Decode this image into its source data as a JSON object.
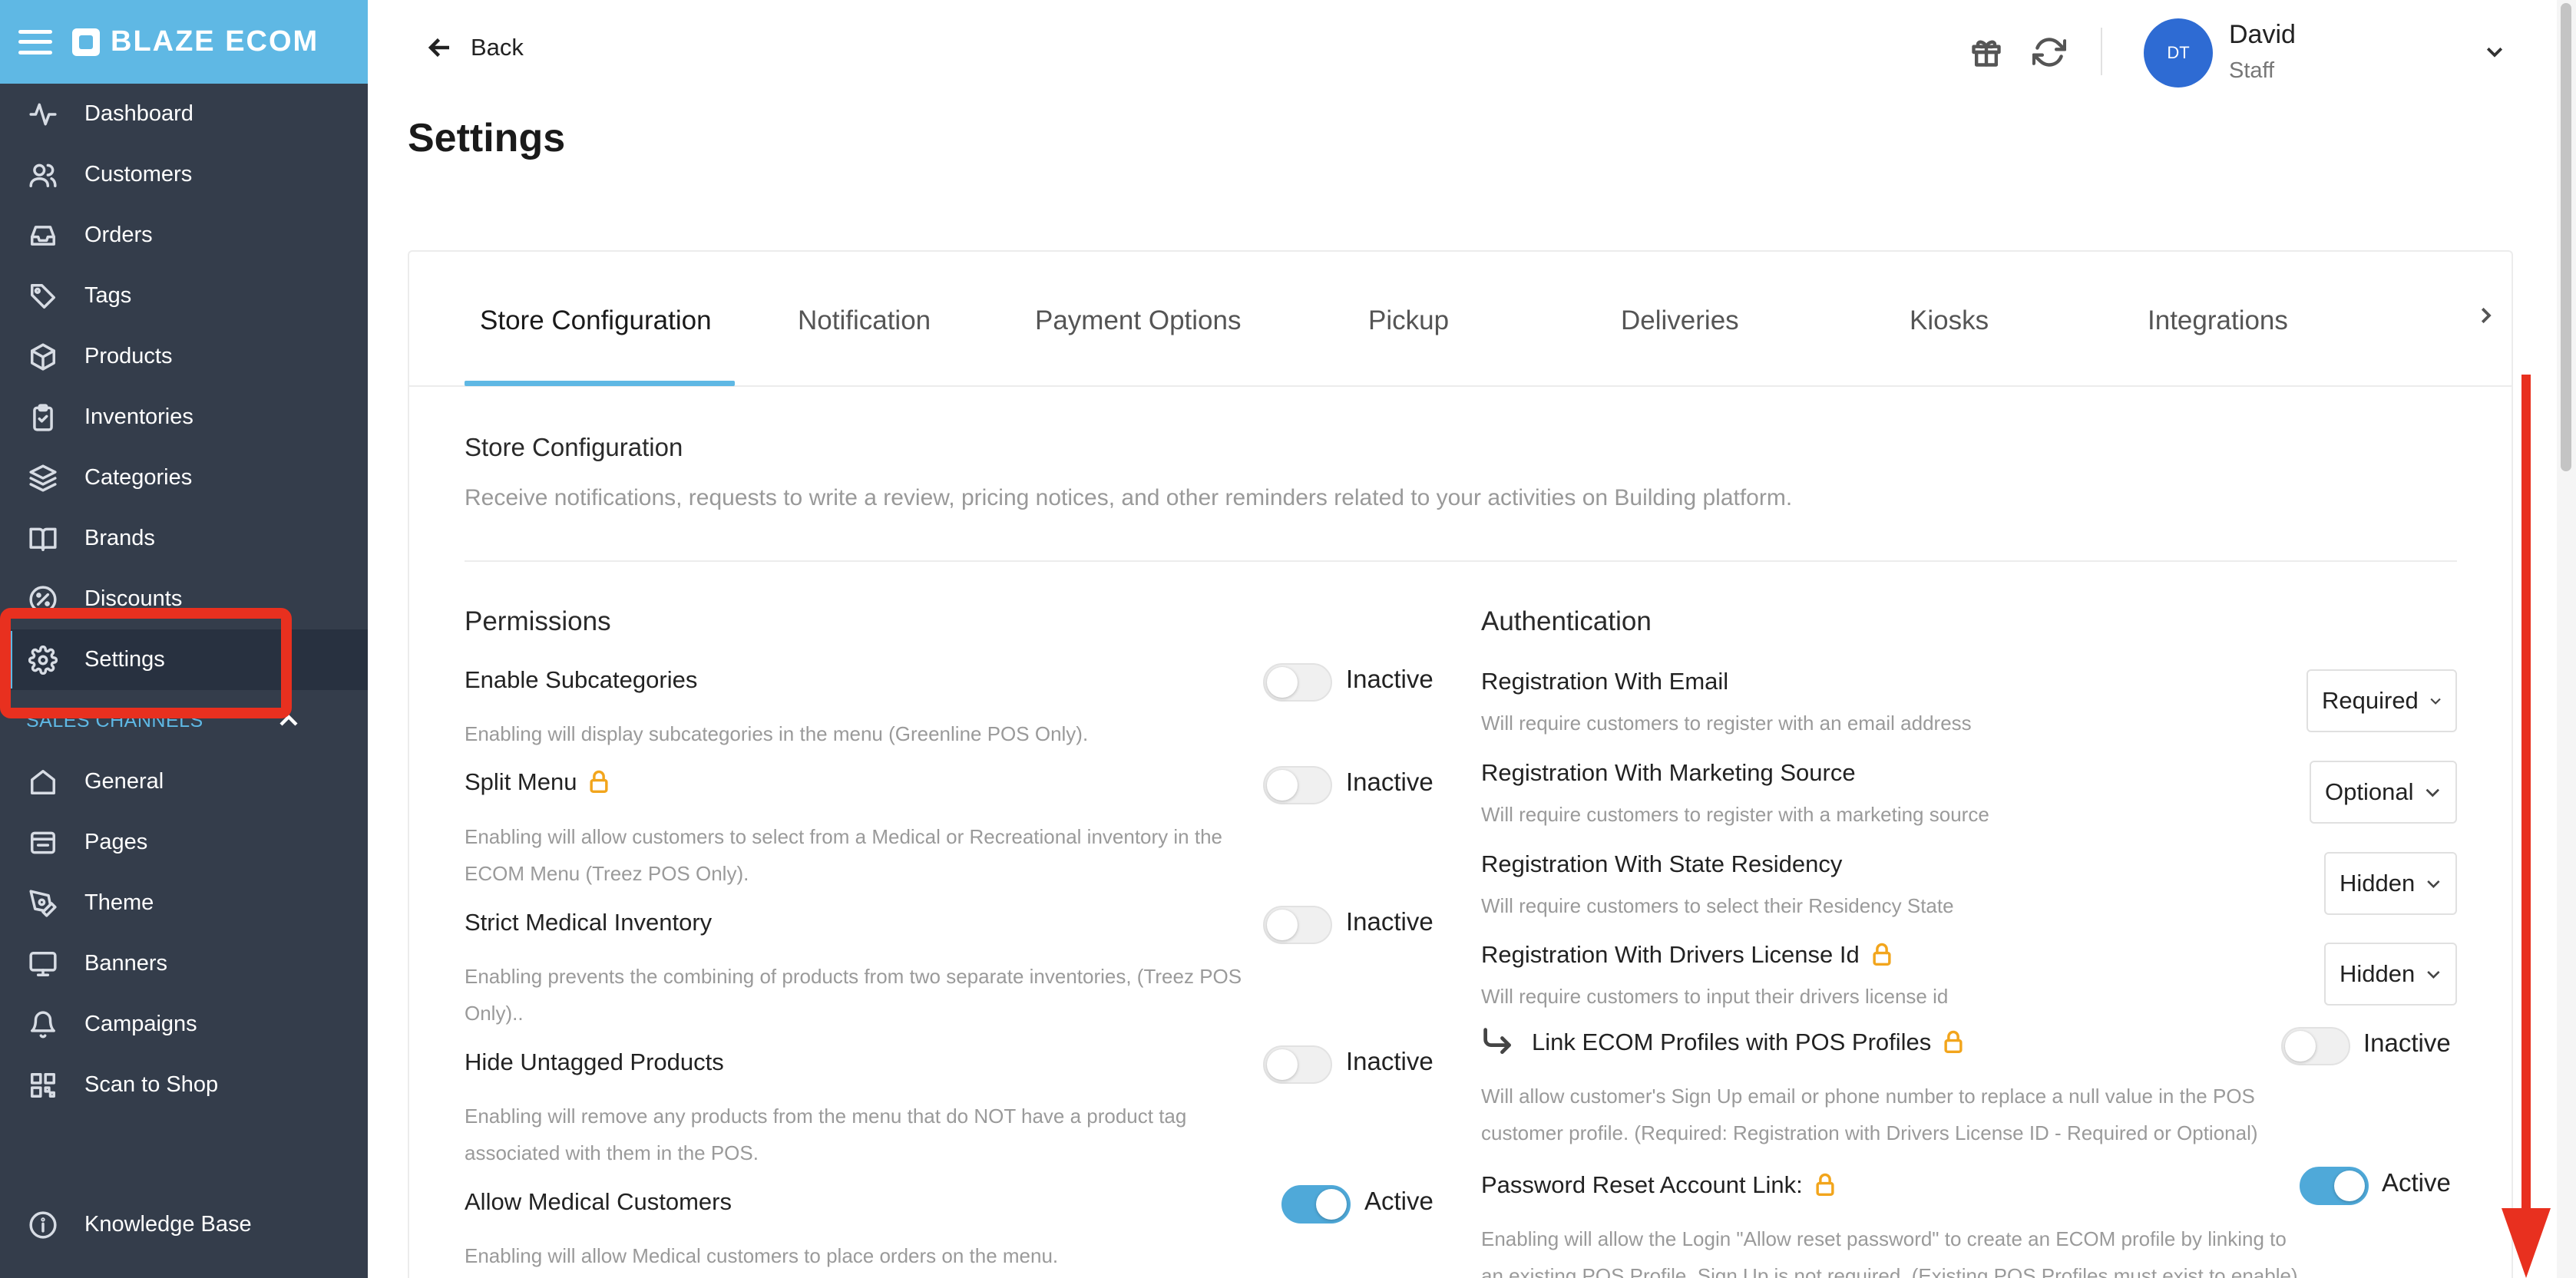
{
  "brand": {
    "name": "BLAZE ECOM"
  },
  "sidebar": {
    "items": [
      {
        "label": "Dashboard"
      },
      {
        "label": "Customers"
      },
      {
        "label": "Orders"
      },
      {
        "label": "Tags"
      },
      {
        "label": "Products"
      },
      {
        "label": "Inventories"
      },
      {
        "label": "Categories"
      },
      {
        "label": "Brands"
      },
      {
        "label": "Discounts"
      },
      {
        "label": "Settings"
      }
    ],
    "sales_channels_label": "SALES CHANNELS",
    "channel_items": [
      {
        "label": "General"
      },
      {
        "label": "Pages"
      },
      {
        "label": "Theme"
      },
      {
        "label": "Banners"
      },
      {
        "label": "Campaigns"
      },
      {
        "label": "Scan to Shop"
      }
    ],
    "knowledge_base_label": "Knowledge Base"
  },
  "header": {
    "back_label": "Back",
    "user_initials": "DT",
    "user_name": "David",
    "user_role": "Staff"
  },
  "page": {
    "title": "Settings"
  },
  "tabs": [
    {
      "label": "Store Configuration"
    },
    {
      "label": "Notification"
    },
    {
      "label": "Payment Options"
    },
    {
      "label": "Pickup"
    },
    {
      "label": "Deliveries"
    },
    {
      "label": "Kiosks"
    },
    {
      "label": "Integrations"
    }
  ],
  "store_config": {
    "title": "Store Configuration",
    "description": "Receive notifications, requests to write a review, pricing notices, and other reminders related to your activities on Building platform."
  },
  "permissions": {
    "title": "Permissions",
    "rows": [
      {
        "label": "Enable Subcategories",
        "state": "Inactive",
        "desc": "Enabling will display subcategories in the menu (Greenline POS Only)."
      },
      {
        "label": "Split Menu",
        "state": "Inactive",
        "desc": "Enabling will allow customers to select from a Medical or Recreational inventory in the ECOM Menu (Treez POS Only)."
      },
      {
        "label": "Strict Medical Inventory",
        "state": "Inactive",
        "desc": "Enabling prevents the combining of products from two separate inventories, (Treez POS Only).."
      },
      {
        "label": "Hide Untagged Products",
        "state": "Inactive",
        "desc": "Enabling will remove any products from the menu that do NOT have a product tag associated with them in the POS."
      },
      {
        "label": "Allow Medical Customers",
        "state": "Active",
        "desc": "Enabling will allow Medical customers to place orders on the menu."
      }
    ]
  },
  "authentication": {
    "title": "Authentication",
    "rows": [
      {
        "label": "Registration With Email",
        "value": "Required",
        "desc": "Will require customers to register with an email address"
      },
      {
        "label": "Registration With Marketing Source",
        "value": "Optional",
        "desc": "Will require customers to register with a marketing source"
      },
      {
        "label": "Registration With State Residency",
        "value": "Hidden",
        "desc": "Will require customers to select their Residency State"
      },
      {
        "label": "Registration With Drivers License Id",
        "value": "Hidden",
        "desc": "Will require customers to input their drivers license id"
      },
      {
        "label": "Link ECOM Profiles with POS Profiles",
        "state": "Inactive",
        "desc": "Will allow customer's Sign Up email or phone number to replace a null value in the POS customer profile. (Required: Registration with Drivers License ID - Required or Optional)"
      },
      {
        "label": "Password Reset Account Link:",
        "state": "Active",
        "desc": "Enabling will allow the Login \"Allow reset password\" to create an ECOM profile by linking to an existing POS Profile. Sign Up is not required. (Existing POS Profiles must exist to enable)"
      }
    ]
  },
  "colors": {
    "sidebar_bg": "#343d4b",
    "brand_blue": "#5fb8e4",
    "toggle_active": "#4fa9d9",
    "highlight_red": "#e8301f",
    "lock_orange": "#f2a51c",
    "avatar_blue": "#2e6bd3"
  }
}
